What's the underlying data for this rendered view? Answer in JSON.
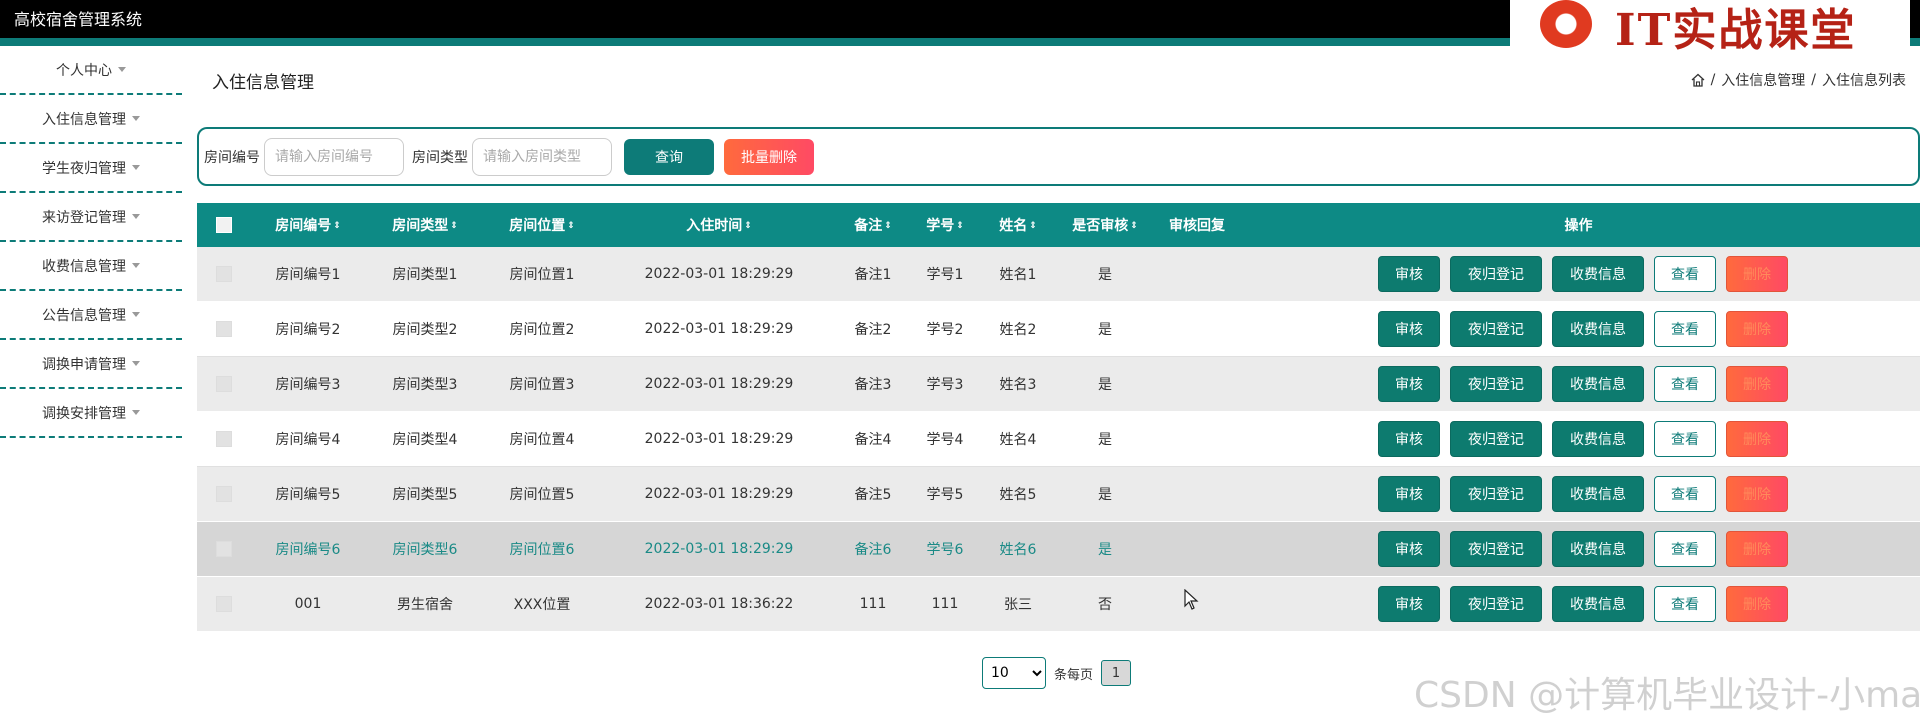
{
  "app": {
    "title": "高校宿舍管理系统"
  },
  "logo": {
    "text": "IT实战课堂"
  },
  "sidebar": {
    "items": [
      {
        "label": "个人中心"
      },
      {
        "label": "入住信息管理"
      },
      {
        "label": "学生夜归管理"
      },
      {
        "label": "来访登记管理"
      },
      {
        "label": "收费信息管理"
      },
      {
        "label": "公告信息管理"
      },
      {
        "label": "调换申请管理"
      },
      {
        "label": "调换安排管理"
      }
    ]
  },
  "page": {
    "title": "入住信息管理"
  },
  "breadcrumb": {
    "level1": "入住信息管理",
    "sep": "/",
    "level2": "入住信息列表"
  },
  "search": {
    "room_label": "房间编号",
    "room_placeholder": "请输入房间编号",
    "type_label": "房间类型",
    "type_placeholder": "请输入房间类型",
    "query_label": "查询",
    "batch_delete_label": "批量删除"
  },
  "table": {
    "headers": {
      "room": "房间编号",
      "type": "房间类型",
      "loc": "房间位置",
      "time": "入住时间",
      "note": "备注",
      "sno": "学号",
      "name": "姓名",
      "aud": "是否审核",
      "reply": "审核回复",
      "ops": "操作"
    },
    "sort_glyph": "⇕",
    "actions": {
      "audit": "审核",
      "night": "夜归登记",
      "fee": "收费信息",
      "view": "查看",
      "del": "删除"
    },
    "rows": [
      {
        "room": "房间编号1",
        "type": "房间类型1",
        "loc": "房间位置1",
        "time": "2022-03-01 18:29:29",
        "note": "备注1",
        "sno": "学号1",
        "name": "姓名1",
        "aud": "是",
        "reply": ""
      },
      {
        "room": "房间编号2",
        "type": "房间类型2",
        "loc": "房间位置2",
        "time": "2022-03-01 18:29:29",
        "note": "备注2",
        "sno": "学号2",
        "name": "姓名2",
        "aud": "是",
        "reply": ""
      },
      {
        "room": "房间编号3",
        "type": "房间类型3",
        "loc": "房间位置3",
        "time": "2022-03-01 18:29:29",
        "note": "备注3",
        "sno": "学号3",
        "name": "姓名3",
        "aud": "是",
        "reply": ""
      },
      {
        "room": "房间编号4",
        "type": "房间类型4",
        "loc": "房间位置4",
        "time": "2022-03-01 18:29:29",
        "note": "备注4",
        "sno": "学号4",
        "name": "姓名4",
        "aud": "是",
        "reply": ""
      },
      {
        "room": "房间编号5",
        "type": "房间类型5",
        "loc": "房间位置5",
        "time": "2022-03-01 18:29:29",
        "note": "备注5",
        "sno": "学号5",
        "name": "姓名5",
        "aud": "是",
        "reply": ""
      },
      {
        "room": "房间编号6",
        "type": "房间类型6",
        "loc": "房间位置6",
        "time": "2022-03-01 18:29:29",
        "note": "备注6",
        "sno": "学号6",
        "name": "姓名6",
        "aud": "是",
        "reply": ""
      },
      {
        "room": "001",
        "type": "男生宿舍",
        "loc": "XXX位置",
        "time": "2022-03-01 18:36:22",
        "note": "111",
        "sno": "111",
        "name": "张三",
        "aud": "否",
        "reply": ""
      }
    ]
  },
  "pager": {
    "page_size": "10",
    "per_page_label": "条每页",
    "current_page": "1"
  },
  "watermark": {
    "text": "CSDN @计算机毕业设计-小ma"
  },
  "colors": {
    "accent": "#0d7b78",
    "header": "#0d8a85",
    "danger": "#ff4a64"
  }
}
